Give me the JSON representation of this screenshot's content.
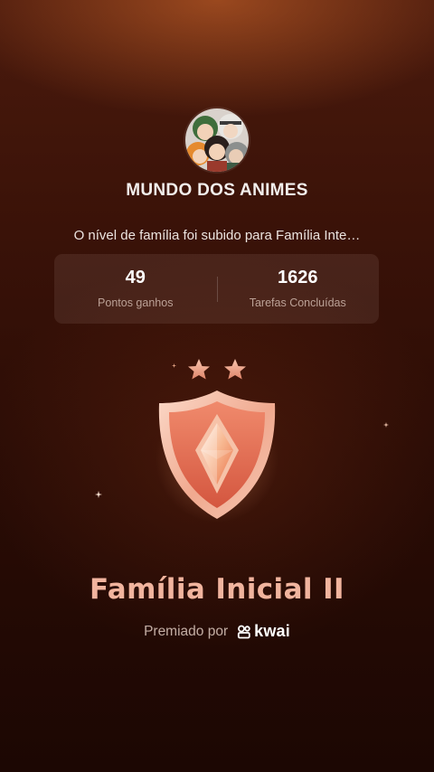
{
  "group": {
    "name": "MUNDO DOS ANIMES",
    "avatar_icon": "anime-characters-avatar"
  },
  "message": "O nível de família foi subido para Família Inte…",
  "stats": {
    "points": {
      "value": "49",
      "label": "Pontos ganhos"
    },
    "tasks": {
      "value": "1626",
      "label": "Tarefas Concluídas"
    }
  },
  "badge": {
    "stars": 2,
    "icon": "shield-diamond-badge",
    "colors": {
      "outer": "#f6c6b2",
      "inner": "#e8745a",
      "gem": "#fbe2cf"
    }
  },
  "level": {
    "name": "Família Inicial II"
  },
  "award": {
    "label": "Premiado por",
    "brand": "kwai",
    "brand_icon": "kwai-logo-icon"
  },
  "colors": {
    "background_top": "#4a1a0d",
    "background_bottom": "#1c0703",
    "level_text": "#f1b49e",
    "star": "#f2a98c"
  }
}
